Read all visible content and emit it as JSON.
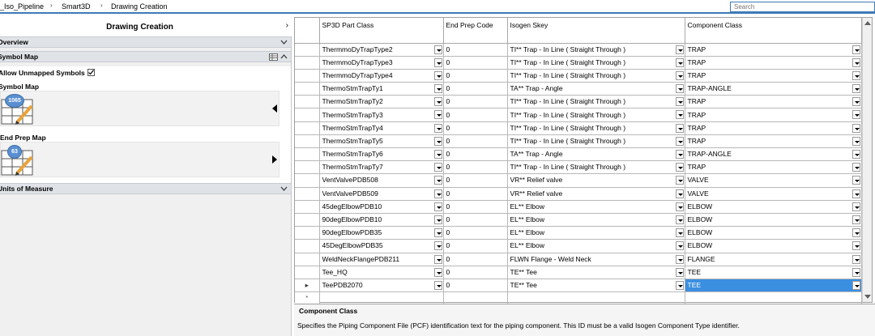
{
  "breadcrumb": {
    "items": [
      "_Iso_Pipeline",
      "Smart3D",
      "Drawing Creation"
    ],
    "separator": "›"
  },
  "search": {
    "placeholder": "Search"
  },
  "left_panel": {
    "title": "Drawing Creation",
    "title_chevron": "›",
    "overview_label": "Overview",
    "symbol_map_section_label": "Symbol Map",
    "allow_unmapped_label": "Allow Unmapped Symbols",
    "allow_unmapped_checked": true,
    "symbol_map": {
      "label": "Symbol Map",
      "count": "1065"
    },
    "end_prep_map": {
      "label": "End Prep Map",
      "count": "63"
    },
    "units_label": "Units of Measure"
  },
  "grid": {
    "columns": [
      "SP3D Part Class",
      "End Prep Code",
      "Isogen Skey",
      "Component Class"
    ],
    "rows": [
      {
        "part": "ThermmoDyTrapType2",
        "prep": "0",
        "skey": "TI** Trap - In Line ( Straight Through )",
        "cls": "TRAP"
      },
      {
        "part": "ThermmoDyTrapType3",
        "prep": "0",
        "skey": "TI** Trap - In Line ( Straight Through )",
        "cls": "TRAP"
      },
      {
        "part": "ThermmoDyTrapType4",
        "prep": "0",
        "skey": "TI** Trap - In Line ( Straight Through )",
        "cls": "TRAP"
      },
      {
        "part": "ThermoStmTrapTy1",
        "prep": "0",
        "skey": "TA** Trap - Angle",
        "cls": "TRAP-ANGLE"
      },
      {
        "part": "ThermoStmTrapTy2",
        "prep": "0",
        "skey": "TI** Trap - In Line ( Straight Through )",
        "cls": "TRAP"
      },
      {
        "part": "ThermoStmTrapTy3",
        "prep": "0",
        "skey": "TI** Trap - In Line ( Straight Through )",
        "cls": "TRAP"
      },
      {
        "part": "ThermoStmTrapTy4",
        "prep": "0",
        "skey": "TI** Trap - In Line ( Straight Through )",
        "cls": "TRAP"
      },
      {
        "part": "ThermoStmTrapTy5",
        "prep": "0",
        "skey": "TI** Trap - In Line ( Straight Through )",
        "cls": "TRAP"
      },
      {
        "part": "ThermoStmTrapTy6",
        "prep": "0",
        "skey": "TA** Trap - Angle",
        "cls": "TRAP-ANGLE"
      },
      {
        "part": "ThermoStmTrapTy7",
        "prep": "0",
        "skey": "TI** Trap - In Line ( Straight Through )",
        "cls": "TRAP"
      },
      {
        "part": "VentValvePDB508",
        "prep": "0",
        "skey": "VR** Relief valve",
        "cls": "VALVE"
      },
      {
        "part": "VentValvePDB509",
        "prep": "0",
        "skey": "VR** Relief valve",
        "cls": "VALVE"
      },
      {
        "part": "45degElbowPDB10",
        "prep": "0",
        "skey": "EL** Elbow",
        "cls": "ELBOW"
      },
      {
        "part": "90degElbowPDB10",
        "prep": "0",
        "skey": "EL** Elbow",
        "cls": "ELBOW"
      },
      {
        "part": "90degElbowPDB35",
        "prep": "0",
        "skey": "EL** Elbow",
        "cls": "ELBOW"
      },
      {
        "part": "45DegElbowPDB35",
        "prep": "0",
        "skey": "EL** Elbow",
        "cls": "ELBOW"
      },
      {
        "part": "WeldNeckFlangePDB211",
        "prep": "0",
        "skey": "FLWN Flange - Weld Neck",
        "cls": "FLANGE"
      },
      {
        "part": "Tee_HQ",
        "prep": "0",
        "skey": "TE** Tee",
        "cls": "TEE"
      },
      {
        "part": "TeePDB2070",
        "prep": "0",
        "skey": "TE** Tee",
        "cls": "TEE",
        "current": true
      }
    ],
    "new_row_marker": "*",
    "current_row_marker": "▸"
  },
  "description": {
    "title": "Component Class",
    "text": "Specifies the Piping Component File (PCF) identification text for the piping component. This ID must be a valid Isogen Component Type identifier."
  },
  "colors": {
    "accent": "#3d7ab8",
    "selection": "#3b8fe0",
    "section_bar": "#dfe3e8"
  }
}
